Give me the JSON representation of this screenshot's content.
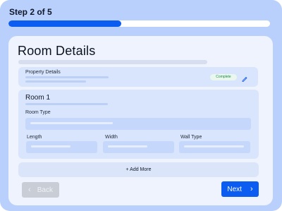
{
  "header": {
    "step_label": "Step 2 of 5",
    "progress_fraction": 0.43
  },
  "main": {
    "title": "Room Details",
    "property": {
      "label": "Property Details",
      "status": "Complete",
      "edit_icon": "pencil-icon"
    },
    "room": {
      "title": "Room 1",
      "room_type_label": "Room Type",
      "length_label": "Length",
      "width_label": "Width",
      "wall_type_label": "Wall Type"
    },
    "add_more_label": "+ Add More"
  },
  "footer": {
    "back_label": "Back",
    "next_label": "Next",
    "back_icon": "chevron-left-icon",
    "next_icon": "chevron-right-icon"
  },
  "colors": {
    "accent": "#0b5cf0",
    "frame": "#b8d0fb",
    "panel": "#d9e5fc",
    "status_complete": "#1b8a45"
  }
}
